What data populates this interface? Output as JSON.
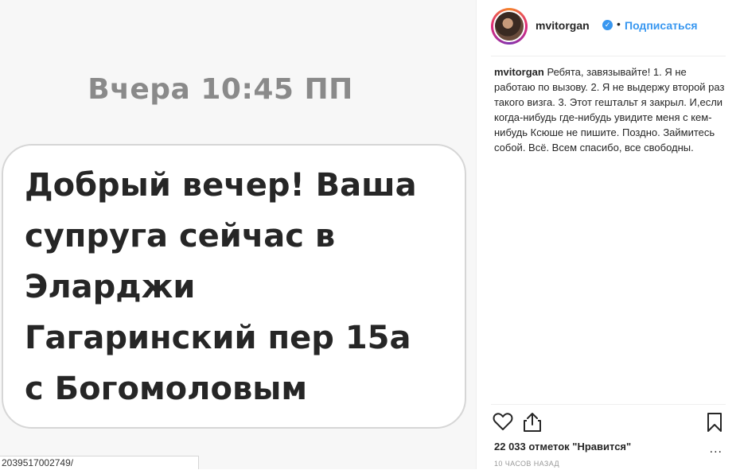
{
  "post": {
    "message_time": "Вчера 10:45 ПП",
    "message_lines": [
      "Добрый вечер! Ваша",
      "супруга сейчас в",
      "Эларджи",
      "Гагаринский пер 15а",
      "с Богомоловым"
    ]
  },
  "browser": {
    "status_url": "2039517002749/"
  },
  "header": {
    "username": "mvitorgan",
    "separator": "•",
    "follow_label": "Подписаться"
  },
  "caption": {
    "username": "mvitorgan",
    "text": "Ребята, завязывайте! 1. Я не работаю по вызову. 2. Я не выдержу второй раз такого визга. 3. Этот гештальт я закрыл. И,если когда-нибудь где-нибудь увидите меня с кем-нибудь Ксюше не пишите. Поздно. Займитесь собой. Всё. Всем спасибо, все свободны."
  },
  "footer": {
    "likes": "22 033 отметок \"Нравится\"",
    "more": "...",
    "time_ago": "10 ЧАСОВ НАЗАД"
  },
  "icons": [
    "heart-icon",
    "share-icon",
    "bookmark-icon",
    "verified-badge-icon"
  ],
  "colors": {
    "link_blue": "#3897f0",
    "text": "#262626",
    "muted": "#999999"
  }
}
